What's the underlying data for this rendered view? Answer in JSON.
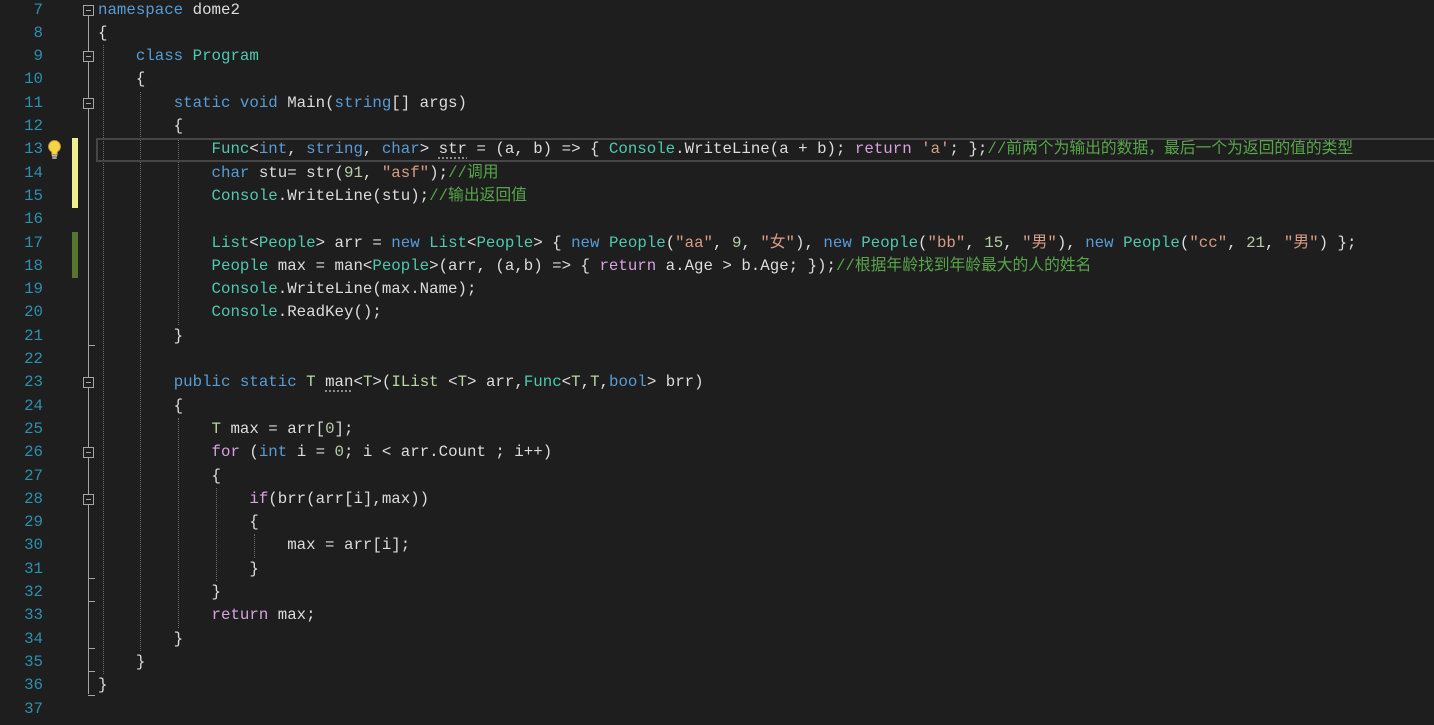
{
  "theme": {
    "background": "#1e1e1e",
    "line_number": "#2b91af",
    "modified_marker": "#efef91",
    "saved_marker": "#577430",
    "outlining": "#a5a5a5",
    "current_line_border": "#464646"
  },
  "editor": {
    "palette": [
      "#dcdcdc",
      "#569cd6",
      "#d8a0df",
      "#4ec9b0",
      "#b8d7a3",
      "#d69d85",
      "#b5cea8",
      "#57a64a"
    ],
    "lines": [
      {
        "n": "7",
        "fold": true,
        "t": [
          [
            "namespace",
            1
          ],
          [
            " dome2",
            0
          ]
        ]
      },
      {
        "n": "8",
        "t": [
          [
            "{",
            0
          ]
        ]
      },
      {
        "n": "9",
        "fold": true,
        "t": [
          [
            "    ",
            0
          ],
          [
            "class",
            1
          ],
          [
            " ",
            0
          ],
          [
            "Program",
            3
          ]
        ]
      },
      {
        "n": "10",
        "t": [
          [
            "    {",
            0
          ]
        ]
      },
      {
        "n": "11",
        "fold": true,
        "t": [
          [
            "        ",
            0
          ],
          [
            "static",
            1
          ],
          [
            " ",
            0
          ],
          [
            "void",
            1
          ],
          [
            " Main(",
            0
          ],
          [
            "string",
            1
          ],
          [
            "[] args)",
            0
          ]
        ]
      },
      {
        "n": "12",
        "t": [
          [
            "        {",
            0
          ]
        ]
      },
      {
        "n": "13",
        "modified": true,
        "current": true,
        "icon": "lightbulb-icon",
        "t": [
          [
            "            ",
            0
          ],
          [
            "Func",
            3
          ],
          [
            "<",
            0
          ],
          [
            "int",
            1
          ],
          [
            ", ",
            0
          ],
          [
            "string",
            1
          ],
          [
            ", ",
            0
          ],
          [
            "char",
            1
          ],
          [
            "> ",
            0
          ],
          [
            "str",
            0,
            1
          ],
          [
            " = (a, b) => { ",
            0
          ],
          [
            "Console",
            3
          ],
          [
            ".WriteLine(a + b); ",
            0
          ],
          [
            "return",
            2
          ],
          [
            " ",
            0
          ],
          [
            "'a'",
            5
          ],
          [
            "; };",
            0
          ],
          [
            "//前两个为输出的数据，最后一个为返回的值的类型",
            7
          ]
        ]
      },
      {
        "n": "14",
        "modified": true,
        "t": [
          [
            "            ",
            0
          ],
          [
            "char",
            1
          ],
          [
            " stu= str(",
            0
          ],
          [
            "91",
            6
          ],
          [
            ", ",
            0
          ],
          [
            "\"asf\"",
            5
          ],
          [
            ");",
            0
          ],
          [
            "//调用",
            7
          ]
        ]
      },
      {
        "n": "15",
        "modified": true,
        "t": [
          [
            "            ",
            0
          ],
          [
            "Console",
            3
          ],
          [
            ".WriteLine(stu);",
            0
          ],
          [
            "//输出返回值",
            7
          ]
        ]
      },
      {
        "n": "16",
        "t": []
      },
      {
        "n": "17",
        "saved": true,
        "t": [
          [
            "            ",
            0
          ],
          [
            "List",
            3
          ],
          [
            "<",
            0
          ],
          [
            "People",
            3
          ],
          [
            "> arr = ",
            0
          ],
          [
            "new",
            1
          ],
          [
            " ",
            0
          ],
          [
            "List",
            3
          ],
          [
            "<",
            0
          ],
          [
            "People",
            3
          ],
          [
            "> { ",
            0
          ],
          [
            "new",
            1
          ],
          [
            " ",
            0
          ],
          [
            "People",
            3
          ],
          [
            "(",
            0
          ],
          [
            "\"aa\"",
            5
          ],
          [
            ", ",
            0
          ],
          [
            "9",
            6
          ],
          [
            ", ",
            0
          ],
          [
            "\"女\"",
            5
          ],
          [
            "), ",
            0
          ],
          [
            "new",
            1
          ],
          [
            " ",
            0
          ],
          [
            "People",
            3
          ],
          [
            "(",
            0
          ],
          [
            "\"bb\"",
            5
          ],
          [
            ", ",
            0
          ],
          [
            "15",
            6
          ],
          [
            ", ",
            0
          ],
          [
            "\"男\"",
            5
          ],
          [
            "), ",
            0
          ],
          [
            "new",
            1
          ],
          [
            " ",
            0
          ],
          [
            "People",
            3
          ],
          [
            "(",
            0
          ],
          [
            "\"cc\"",
            5
          ],
          [
            ", ",
            0
          ],
          [
            "21",
            6
          ],
          [
            ", ",
            0
          ],
          [
            "\"男\"",
            5
          ],
          [
            ") };",
            0
          ]
        ]
      },
      {
        "n": "18",
        "saved": true,
        "t": [
          [
            "            ",
            0
          ],
          [
            "People",
            3
          ],
          [
            " max = man<",
            0
          ],
          [
            "People",
            3
          ],
          [
            ">(arr, (a,b) => { ",
            0
          ],
          [
            "return",
            2
          ],
          [
            " a.Age > b.Age; });",
            0
          ],
          [
            "//根据年龄找到年龄最大的人的姓名",
            7
          ]
        ]
      },
      {
        "n": "19",
        "t": [
          [
            "            ",
            0
          ],
          [
            "Console",
            3
          ],
          [
            ".WriteLine(max.Name);",
            0
          ]
        ]
      },
      {
        "n": "20",
        "t": [
          [
            "            ",
            0
          ],
          [
            "Console",
            3
          ],
          [
            ".ReadKey();",
            0
          ]
        ]
      },
      {
        "n": "21",
        "fold_end": true,
        "t": [
          [
            "        }",
            0
          ]
        ]
      },
      {
        "n": "22",
        "t": []
      },
      {
        "n": "23",
        "fold": true,
        "t": [
          [
            "        ",
            0
          ],
          [
            "public",
            1
          ],
          [
            " ",
            0
          ],
          [
            "static",
            1
          ],
          [
            " ",
            0
          ],
          [
            "T",
            4
          ],
          [
            " ",
            0
          ],
          [
            "man",
            0,
            1
          ],
          [
            "<",
            0
          ],
          [
            "T",
            4
          ],
          [
            ">(",
            0
          ],
          [
            "IList",
            4
          ],
          [
            " <",
            0
          ],
          [
            "T",
            4
          ],
          [
            "> arr,",
            0
          ],
          [
            "Func",
            3
          ],
          [
            "<",
            0
          ],
          [
            "T",
            4
          ],
          [
            ",",
            0
          ],
          [
            "T",
            4
          ],
          [
            ",",
            0
          ],
          [
            "bool",
            1
          ],
          [
            "> brr)",
            0
          ]
        ]
      },
      {
        "n": "24",
        "t": [
          [
            "        {",
            0
          ]
        ]
      },
      {
        "n": "25",
        "t": [
          [
            "            ",
            0
          ],
          [
            "T",
            4
          ],
          [
            " max = arr[",
            0
          ],
          [
            "0",
            6
          ],
          [
            "];",
            0
          ]
        ]
      },
      {
        "n": "26",
        "fold": true,
        "t": [
          [
            "            ",
            0
          ],
          [
            "for",
            2
          ],
          [
            " (",
            0
          ],
          [
            "int",
            1
          ],
          [
            " i = ",
            0
          ],
          [
            "0",
            6
          ],
          [
            "; i < arr.Count ; i++)",
            0
          ]
        ]
      },
      {
        "n": "27",
        "t": [
          [
            "            {",
            0
          ]
        ]
      },
      {
        "n": "28",
        "fold": true,
        "t": [
          [
            "                ",
            0
          ],
          [
            "if",
            2
          ],
          [
            "(brr(arr[i],max))",
            0
          ]
        ]
      },
      {
        "n": "29",
        "t": [
          [
            "                {",
            0
          ]
        ]
      },
      {
        "n": "30",
        "t": [
          [
            "                    max = arr[i];",
            0
          ]
        ]
      },
      {
        "n": "31",
        "fold_end": true,
        "t": [
          [
            "                }",
            0
          ]
        ]
      },
      {
        "n": "32",
        "fold_end": true,
        "t": [
          [
            "            }",
            0
          ]
        ]
      },
      {
        "n": "33",
        "t": [
          [
            "            ",
            0
          ],
          [
            "return",
            2
          ],
          [
            " max;",
            0
          ]
        ]
      },
      {
        "n": "34",
        "fold_end": true,
        "t": [
          [
            "        }",
            0
          ]
        ]
      },
      {
        "n": "35",
        "fold_end": true,
        "t": [
          [
            "    }",
            0
          ]
        ]
      },
      {
        "n": "36",
        "fold_end": true,
        "t": [
          [
            "}",
            0
          ]
        ]
      },
      {
        "n": "37",
        "t": []
      }
    ]
  }
}
